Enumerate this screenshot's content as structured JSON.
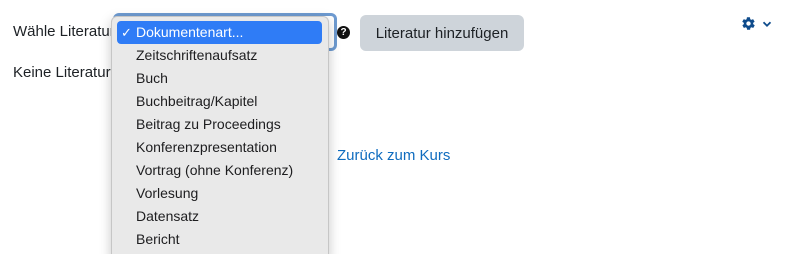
{
  "form": {
    "select_label": "Wähle Literatur",
    "help_icon": "question-circle-icon",
    "add_button_label": "Literatur hinzufügen"
  },
  "empty_state": {
    "text": "Keine Literatur"
  },
  "dropdown": {
    "selected": "Dokumentenart...",
    "options": [
      "Dokumentenart...",
      "Zeitschriftenaufsatz",
      "Buch",
      "Buchbeitrag/Kapitel",
      "Beitrag zu Proceedings",
      "Konferenzpresentation",
      "Vortrag (ohne Konferenz)",
      "Vorlesung",
      "Datensatz",
      "Bericht"
    ]
  },
  "nav": {
    "back_link": "Zurück zum Kurs"
  },
  "settings_menu": {
    "icon": "gear-icon",
    "caret_icon": "chevron-down-icon"
  },
  "colors": {
    "link": "#0f6cbf",
    "selected_option": "#2f7cf6",
    "button_bg": "#ced4da"
  }
}
